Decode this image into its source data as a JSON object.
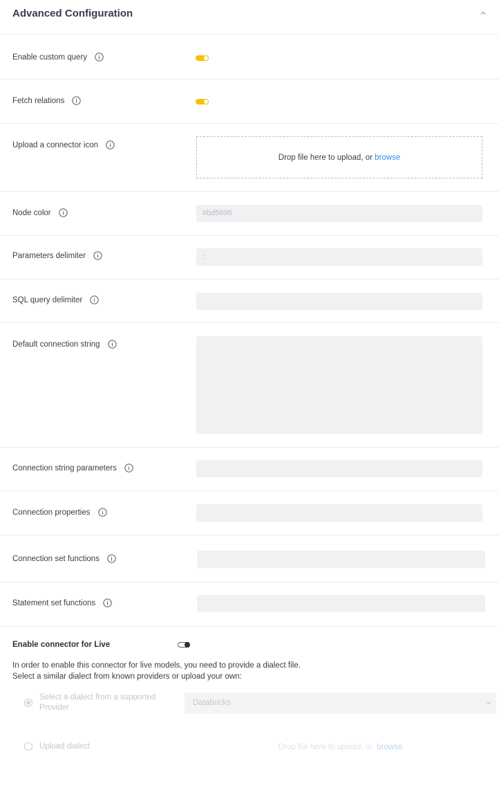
{
  "header": {
    "title": "Advanced Configuration"
  },
  "fields": {
    "enable_custom_query": {
      "label": "Enable custom query"
    },
    "fetch_relations": {
      "label": "Fetch relations"
    },
    "upload_icon": {
      "label": "Upload a connector icon",
      "drop_text": "Drop file here to upload, or ",
      "browse": "browse"
    },
    "node_color": {
      "label": "Node color",
      "value": "#bd5696"
    },
    "parameters_delimiter": {
      "label": "Parameters delimiter",
      "value": ";"
    },
    "sql_query_delimiter": {
      "label": "SQL query delimiter",
      "value": ""
    },
    "default_connection_string": {
      "label": "Default connection string",
      "value": ""
    },
    "connection_string_parameters": {
      "label": "Connection string parameters",
      "value": ""
    },
    "connection_properties": {
      "label": "Connection properties",
      "value": ""
    },
    "connection_set_functions": {
      "label": "Connection set functions",
      "value": ""
    },
    "statement_set_functions": {
      "label": "Statement set functions",
      "value": ""
    }
  },
  "live": {
    "title": "Enable connector for Live",
    "desc_line1": "In order to enable this connector for live models, you need to provide a dialect file.",
    "desc_line2": "Select a similar dialect from known providers or upload your own:",
    "option_provider_line1": "Select a dialect from a supported",
    "option_provider_line2": "Provider",
    "provider_selected": "Databricks",
    "option_upload": "Upload dialect",
    "upload_drop_text": "Drop file here to upload, or ",
    "upload_browse": "browse"
  },
  "colors": {
    "accent_toggle": "#f2c200",
    "link": "#2f8ee8"
  }
}
